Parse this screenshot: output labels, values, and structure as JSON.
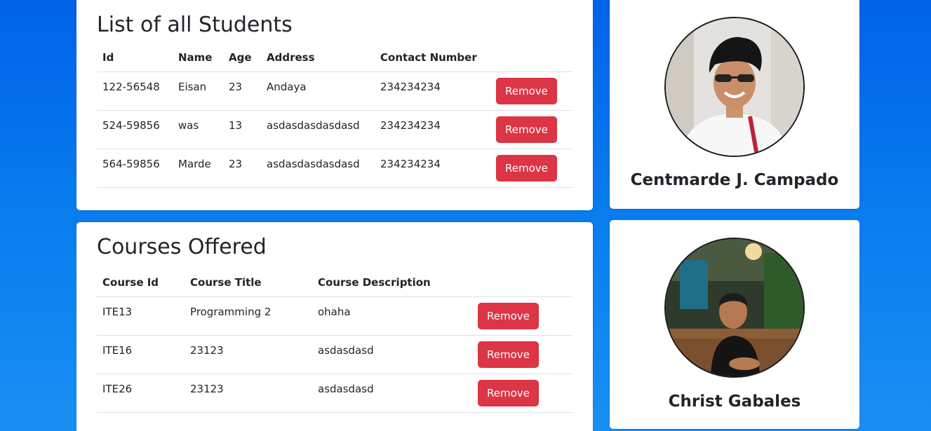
{
  "students": {
    "title": "List of all Students",
    "columns": [
      "Id",
      "Name",
      "Age",
      "Address",
      "Contact Number"
    ],
    "rows": [
      {
        "id": "122-56548",
        "name": "Eisan",
        "age": "23",
        "address": "Andaya",
        "contact": "234234234",
        "action": "Remove"
      },
      {
        "id": "524-59856",
        "name": "was",
        "age": "13",
        "address": "asdasdasdasdasd",
        "contact": "234234234",
        "action": "Remove"
      },
      {
        "id": "564-59856",
        "name": "Marde",
        "age": "23",
        "address": "asdasdasdasdasd",
        "contact": "234234234",
        "action": "Remove"
      }
    ]
  },
  "courses": {
    "title": "Courses Offered",
    "columns": [
      "Course Id",
      "Course Title",
      "Course Description"
    ],
    "rows": [
      {
        "id": "ITE13",
        "title": "Programming 2",
        "description": "ohaha",
        "action": "Remove"
      },
      {
        "id": "ITE16",
        "title": "23123",
        "description": "asdasdasd",
        "action": "Remove"
      },
      {
        "id": "ITE26",
        "title": "23123",
        "description": "asdasdasd",
        "action": "Remove"
      }
    ]
  },
  "profiles": [
    {
      "name": "Centmarde J. Campado"
    },
    {
      "name": "Christ Gabales"
    }
  ],
  "colors": {
    "background_top": "#0063e8",
    "background_bottom": "#1a8ff2",
    "remove_button": "#dc3545"
  }
}
